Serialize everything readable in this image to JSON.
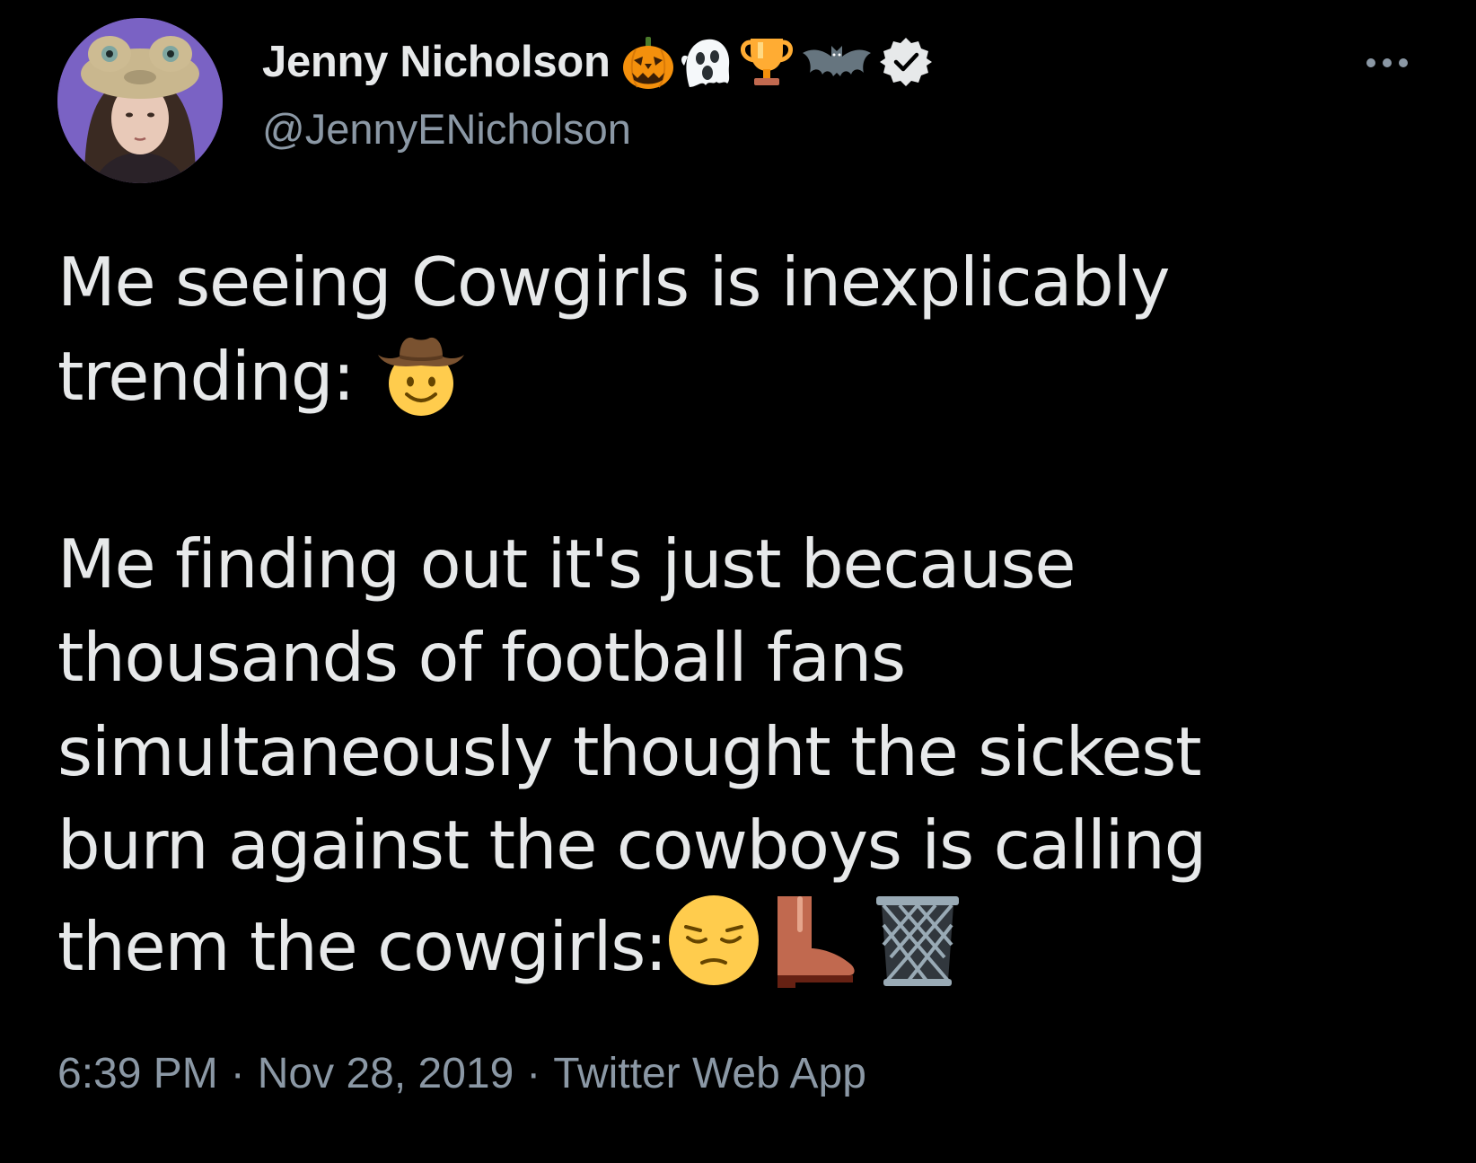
{
  "tweet": {
    "author": {
      "display_name": "Jenny Nicholson",
      "name_emojis": [
        "pumpkin-icon",
        "ghost-icon",
        "trophy-icon",
        "bat-icon"
      ],
      "verified_icon": "verified-badge-icon",
      "handle": "@JennyENicholson"
    },
    "menu_icon": "more-options-icon",
    "text_lines": {
      "l1": "Me seeing Cowgirls is inexplicably",
      "l2": "trending: ",
      "l3": "Me finding out it's just because",
      "l4": "thousands of football fans",
      "l5": "simultaneously thought the sickest",
      "l6": "burn against the cowboys is calling",
      "l7": "them the cowgirls:"
    },
    "inline_emojis": [
      "cowboy-face-icon",
      "pensive-face-icon",
      "boot-icon",
      "wastebasket-icon"
    ],
    "timestamp": {
      "time": "6:39 PM",
      "separator": "·",
      "date": "Nov 28, 2019",
      "source": "Twitter Web App"
    }
  },
  "colors": {
    "background": "#000000",
    "text": "#e7e9ea",
    "secondary": "#8b98a5"
  }
}
